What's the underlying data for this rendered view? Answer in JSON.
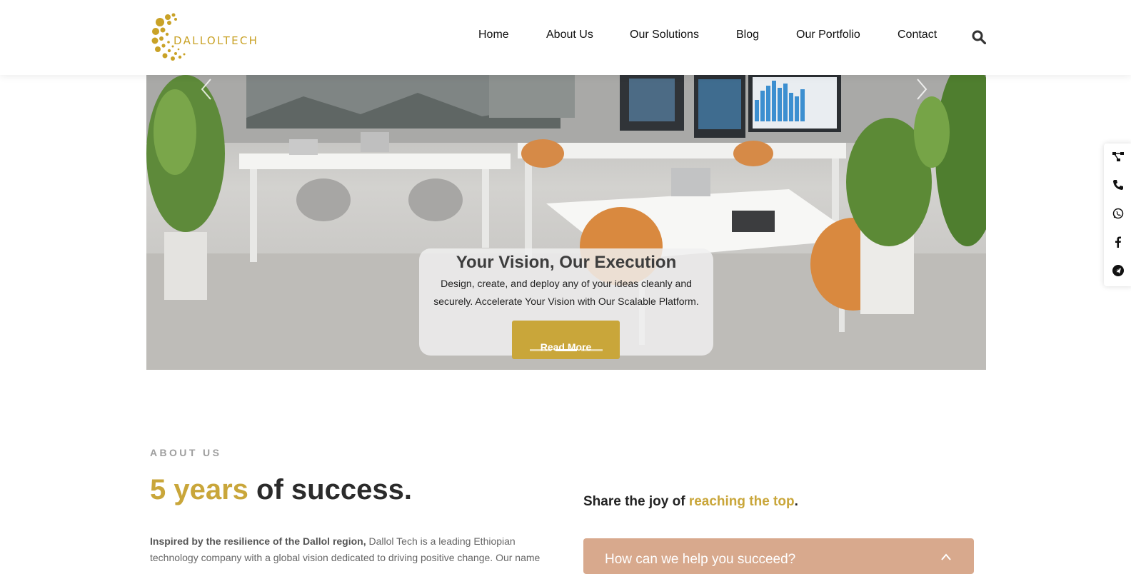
{
  "brand": {
    "name": "DALLOLTECH",
    "color": "#c9a227"
  },
  "nav": {
    "items": [
      {
        "label": "Home"
      },
      {
        "label": "About Us"
      },
      {
        "label": "Our Solutions"
      },
      {
        "label": "Blog"
      },
      {
        "label": "Our Portfolio"
      },
      {
        "label": "Contact"
      }
    ],
    "search_icon": "search-icon"
  },
  "hero": {
    "title": "Your Vision, Our Execution",
    "text": "Design, create, and deploy any of your ideas cleanly and securely. Accelerate Your Vision with Our Scalable Platform.",
    "button_label": "Read More",
    "slides_count": 3,
    "active_slide": 2
  },
  "social": {
    "icons": [
      "share-network-icon",
      "phone-icon",
      "whatsapp-icon",
      "facebook-icon",
      "telegram-icon"
    ]
  },
  "about": {
    "label": "ABOUT US",
    "title_highlight": "5 years",
    "title_rest": " of success.",
    "body_bold": "Inspired by the resilience of the Dallol region,",
    "body_text": " Dallol Tech is a leading Ethiopian technology company with a global vision dedicated to driving positive change. Our name",
    "share_prefix": "Share the joy of ",
    "share_highlight": "reaching the top",
    "share_suffix": ".",
    "accordion_title": "How can we help you succeed?"
  },
  "colors": {
    "accent": "#c9a63a",
    "accordion": "#d8a98d"
  }
}
